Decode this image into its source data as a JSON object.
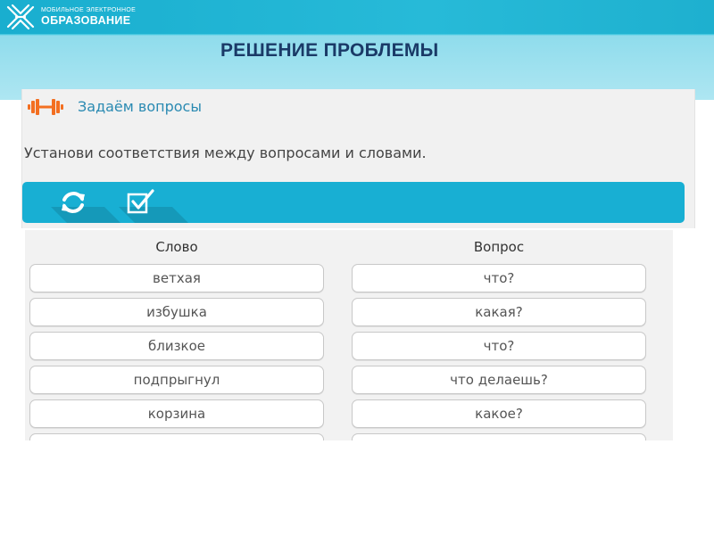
{
  "header": {
    "logo_line1": "МОБИЛЬНОЕ ЭЛЕКТРОННОЕ",
    "logo_line2": "ОБРАЗОВАНИЕ",
    "page_title": "РЕШЕНИЕ ПРОБЛЕМЫ"
  },
  "task": {
    "title": "Задаём вопросы",
    "instruction": "Установи соответствия между вопросами и словами.",
    "toolbar": {
      "icons": [
        "refresh-icon",
        "check-icon"
      ]
    }
  },
  "matching": {
    "left_header": "Слово",
    "right_header": "Вопрос",
    "words": [
      "ветхая",
      "избушка",
      "близкое",
      "подпрыгнул",
      "корзина"
    ],
    "questions": [
      "что?",
      "какая?",
      "что?",
      "что делаешь?",
      "какое?"
    ]
  },
  "colors": {
    "banner": "#23b8d6",
    "title": "#1a3a67",
    "accent": "#f36f21",
    "toolbar": "#18afd3",
    "task_title": "#2a8ab2"
  }
}
